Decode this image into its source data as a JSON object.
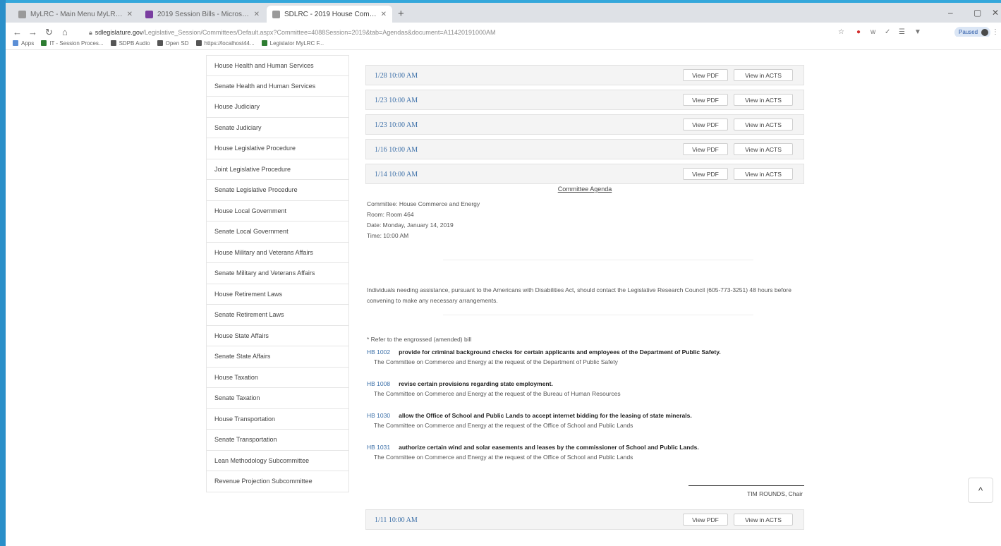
{
  "browser": {
    "tabs": [
      {
        "label": "MyLRC - Main Menu MyLRC - H",
        "icon_color": "#9a9a9a",
        "active": false
      },
      {
        "label": "2019 Session Bills - Microsoft D",
        "icon_color": "#7a3ea0",
        "active": false
      },
      {
        "label": "SDLRC - 2019 House Commerc",
        "icon_color": "#9a9a9a",
        "active": true
      }
    ],
    "new_tab": "+",
    "window_controls": [
      "–",
      "▢",
      "✕"
    ],
    "address": {
      "host": "sdlegislature.gov",
      "path": "/Legislative_Session/Committees/Default.aspx?Committee=4088Session=2019&tab=Agendas&document=A11420191000AM"
    },
    "paused_label": "Paused",
    "bookmarks": [
      {
        "label": "Apps",
        "color": "#5c8fd6"
      },
      {
        "label": "IT - Session Proces...",
        "color": "#2e7d32"
      },
      {
        "label": "SDPB Audio",
        "color": "#555555"
      },
      {
        "label": "Open SD",
        "color": "#555555"
      },
      {
        "label": "https://localhost44...",
        "color": "#555555"
      },
      {
        "label": "Legislator MyLRC F...",
        "color": "#2e7d32"
      }
    ]
  },
  "sidebar": {
    "items": [
      "House Health and Human Services",
      "Senate Health and Human Services",
      "House Judiciary",
      "Senate Judiciary",
      "House Legislative Procedure",
      "Joint Legislative Procedure",
      "Senate Legislative Procedure",
      "House Local Government",
      "Senate Local Government",
      "House Military and Veterans Affairs",
      "Senate Military and Veterans Affairs",
      "House Retirement Laws",
      "Senate Retirement Laws",
      "House State Affairs",
      "Senate State Affairs",
      "House Taxation",
      "Senate Taxation",
      "House Transportation",
      "Senate Transportation",
      "Lean Methodology Subcommittee",
      "Revenue Projection Subcommittee"
    ]
  },
  "agendas": [
    {
      "date": "1/28 10:00 AM"
    },
    {
      "date": "1/23 10:00 AM"
    },
    {
      "date": "1/23 10:00 AM"
    },
    {
      "date": "1/16 10:00 AM"
    },
    {
      "date": "1/14 10:00 AM"
    },
    {
      "date": "1/11 10:00 AM"
    }
  ],
  "buttons": {
    "view_pdf": "View PDF",
    "view_acts": "View in ACTS"
  },
  "agenda_detail": {
    "title": "Committee Agenda",
    "committee": "Committee:   House Commerce and Energy",
    "room": "Room:    Room 464",
    "date": "Date:   Monday, January 14, 2019",
    "time": "Time:    10:00 AM",
    "notice": "Individuals needing assistance, pursuant to the Americans with Disabilities Act, should contact the Legislative Research Council (605-773-3251) 48 hours before convening to make any necessary arrangements.",
    "ref_note": "* Refer to the engrossed (amended) bill",
    "bills": [
      {
        "num": "HB 1002",
        "desc": "provide for criminal background checks for certain applicants and employees of the Department of Public Safety.",
        "req": "The Committee on Commerce and Energy at the request of the Department of Public Safety"
      },
      {
        "num": "HB 1008",
        "desc": "revise certain provisions regarding state employment.",
        "req": "The Committee on Commerce and Energy at the request of the Bureau of Human Resources"
      },
      {
        "num": "HB 1030",
        "desc": "allow the Office of School and Public Lands to accept internet bidding for the leasing of state minerals.",
        "req": "The Committee on Commerce and Energy at the request of the Office of School and Public Lands"
      },
      {
        "num": "HB 1031",
        "desc": "authorize certain wind and solar easements and leases by the commissioner of School and Public Lands.",
        "req": "The Committee on Commerce and Energy at the request of the Office of School and Public Lands"
      }
    ],
    "chair": "TIM ROUNDS, Chair"
  },
  "scroll_top_icon": "^"
}
